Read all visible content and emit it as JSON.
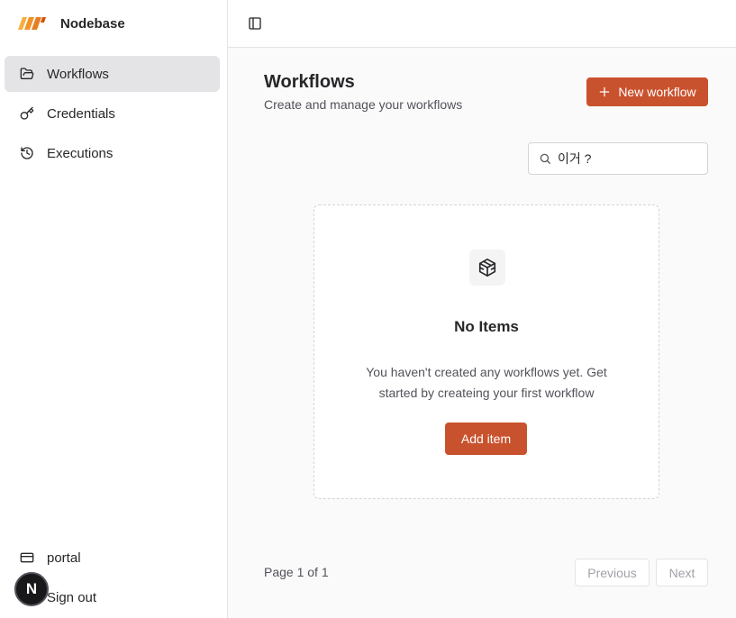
{
  "app": {
    "name": "Nodebase",
    "brand_color": "#f0932b"
  },
  "sidebar": {
    "items": [
      {
        "label": "Workflows",
        "icon": "folder-open-icon",
        "active": true
      },
      {
        "label": "Credentials",
        "icon": "key-icon",
        "active": false
      },
      {
        "label": "Executions",
        "icon": "history-icon",
        "active": false
      }
    ],
    "bottom": [
      {
        "label": "portal",
        "icon": "credit-card-icon"
      },
      {
        "label": "Sign out",
        "icon": "log-out-icon"
      }
    ],
    "avatar_letter": "N"
  },
  "header": {
    "toggle_icon": "panel-left-icon"
  },
  "main": {
    "title": "Workflows",
    "subtitle": "Create and manage your workflows",
    "new_button_label": "New workflow",
    "search": {
      "value": "이거 ?",
      "icon": "search-icon"
    },
    "empty_state": {
      "icon": "package-icon",
      "title": "No Items",
      "description": "You haven't created any workflows yet. Get started by createing your first workflow",
      "button_label": "Add item"
    },
    "pagination": {
      "text": "Page 1 of 1",
      "prev_label": "Previous",
      "next_label": "Next"
    }
  },
  "colors": {
    "accent": "#c9522e",
    "active_nav_bg": "#e4e4e7"
  }
}
